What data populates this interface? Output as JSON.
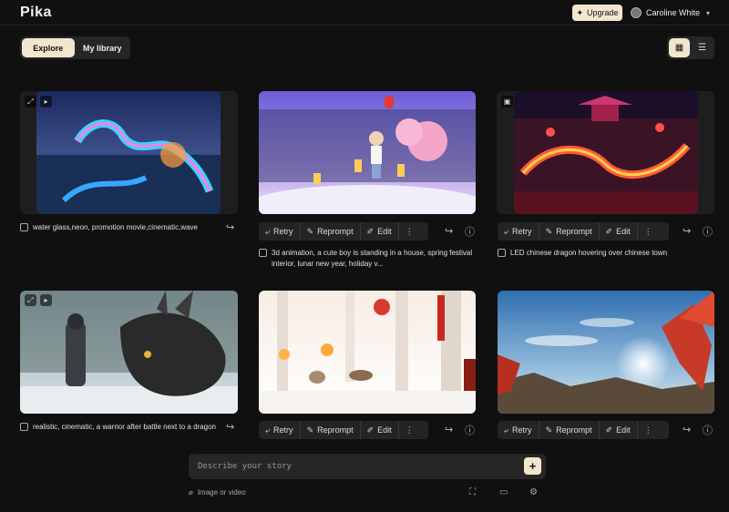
{
  "app": {
    "logo": "Pika"
  },
  "header": {
    "upgrade_label": "Upgrade",
    "user_name": "Caroline White"
  },
  "tabs": [
    {
      "label": "Explore",
      "active": true
    },
    {
      "label": "My library",
      "active": false
    }
  ],
  "actions": {
    "retry": "Retry",
    "reprompt": "Reprompt",
    "edit": "Edit"
  },
  "cards": [
    {
      "caption": "water glass,neon, promotion movie,cinematic,wave",
      "scene": "neon-dragon",
      "media": "video",
      "actions_visible": false
    },
    {
      "caption": "3d animation, a cute boy is standing in a house, spring festival interior, lunar new year, holiday v...",
      "scene": "cute-boy",
      "media": "none",
      "actions_visible": true
    },
    {
      "caption": "LED chinese dragon hovering over chinese town",
      "scene": "led-dragon",
      "media": "image",
      "actions_visible": true
    },
    {
      "caption": "realistic, cinematic, a warrior after battle next to a dragon",
      "scene": "warrior-dragon",
      "media": "video",
      "actions_visible": false
    },
    {
      "caption": "",
      "scene": "snow-forest",
      "media": "none",
      "actions_visible": true
    },
    {
      "caption": "",
      "scene": "red-dragon-sky",
      "media": "none",
      "actions_visible": true
    }
  ],
  "composer": {
    "placeholder": "Describe your story",
    "attach_label": "Image or video"
  },
  "colors": {
    "background": "#101010",
    "accent": "#f3e6cf",
    "surface": "#262626"
  }
}
